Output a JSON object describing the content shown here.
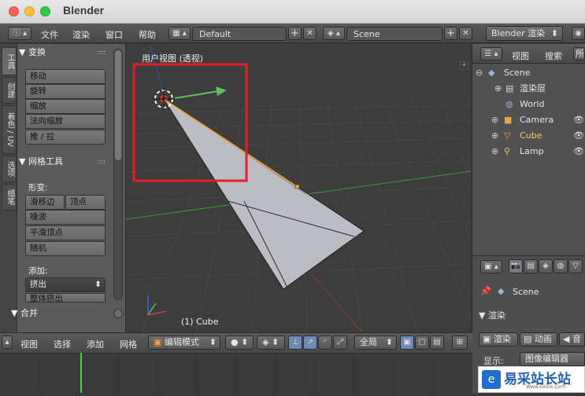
{
  "app": {
    "title": "Blender"
  },
  "menu": {
    "file": "文件",
    "render": "渲染",
    "window": "窗口",
    "help": "帮助"
  },
  "layout": {
    "screen": "Default",
    "scene": "Scene",
    "engine": "Blender 渲染"
  },
  "tabs": [
    "工具",
    "创建",
    "着色 / UV",
    "选项",
    "蜡笔"
  ],
  "transform": {
    "title": "变换",
    "buttons": [
      "移动",
      "旋转",
      "缩放",
      "法向缩放",
      "推 / 拉"
    ]
  },
  "mesh_tools": {
    "title": "网格工具",
    "deform_label": "形变:",
    "slide_edge": "滑移边",
    "vertex": "顶点",
    "noise": "噪波",
    "smooth_vertex": "平滑顶点",
    "random": "随机",
    "add_label": "添加:",
    "extrude": "挤出",
    "extrude_region": "整体挤出"
  },
  "merge": {
    "title": "合并"
  },
  "viewport": {
    "label": "用户视图 (透视)",
    "object_label": "(1) Cube"
  },
  "outliner": {
    "view": "视图",
    "search": "搜索",
    "all": "所",
    "items": [
      {
        "name": "Scene"
      },
      {
        "name": "渲染层"
      },
      {
        "name": "World"
      },
      {
        "name": "Camera"
      },
      {
        "name": "Cube"
      },
      {
        "name": "Lamp"
      }
    ]
  },
  "properties": {
    "scene": "Scene",
    "render_section": "渲染",
    "tabs": [
      "渲染",
      "动画",
      "音"
    ],
    "display_label": "显示:",
    "display_value": "图像编辑器"
  },
  "bottom": {
    "view": "视图",
    "select": "选择",
    "add": "添加",
    "mesh": "网格",
    "mode": "编辑模式",
    "pivot": "全局"
  },
  "watermark": {
    "text": "易采站长站",
    "sub": "Www.Easck.Com"
  },
  "colors": {
    "accent_red": "#e31e24",
    "axis_green": "#5ec15e",
    "axis_red": "#c44040",
    "axis_blue": "#4060c8",
    "selection_orange": "#f8a02a"
  }
}
